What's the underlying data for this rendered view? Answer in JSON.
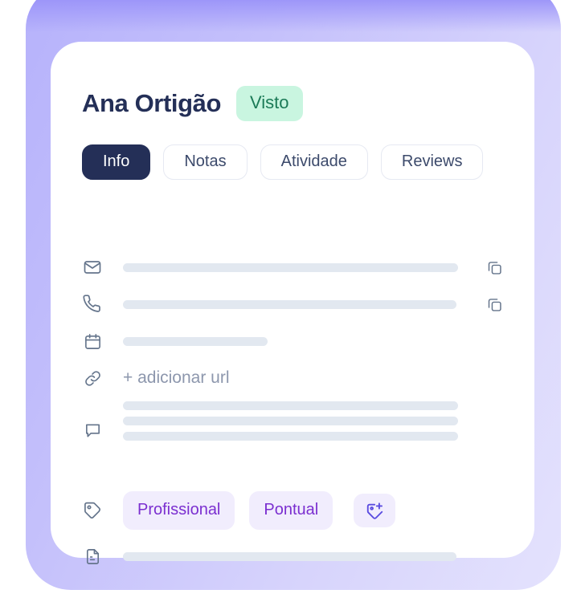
{
  "card": {
    "person_name": "Ana Ortigão",
    "status_badge": "Visto",
    "tabs": [
      {
        "label": "Info",
        "active": true
      },
      {
        "label": "Notas",
        "active": false
      },
      {
        "label": "Atividade",
        "active": false
      },
      {
        "label": "Reviews",
        "active": false
      }
    ],
    "rows": {
      "mail": {
        "icon": "mail-icon",
        "value": "",
        "copy_icon": "copy-icon"
      },
      "phone": {
        "icon": "phone-icon",
        "value": "",
        "copy_icon": "copy-icon"
      },
      "date": {
        "icon": "calendar-icon",
        "value": ""
      },
      "url": {
        "icon": "link-icon",
        "action_label": "+ adicionar url"
      },
      "notes": {
        "icon": "chat-bubble-icon",
        "value": ""
      },
      "tags": {
        "icon": "tag-icon",
        "chips": [
          "Profissional",
          "Pontual"
        ],
        "add_button_icon": "tag-plus-icon"
      },
      "file": {
        "icon": "document-icon",
        "value": ""
      }
    }
  },
  "colors": {
    "frame_purple": "#b6b2fb",
    "frame_purple_light": "#e4e2fd",
    "frame_glow": "#7d74f7",
    "card_bg": "#ffffff",
    "name_navy": "#242f57",
    "badge_bg": "#c9f5e0",
    "badge_text": "#1b7a57",
    "tab_active_bg": "#242f57",
    "tab_border": "#e6e9f2",
    "tab_text": "#3c4a6b",
    "placeholder_bar": "#e2e8f0",
    "icon_slate": "#64748b",
    "muted_text": "#8d97ad",
    "chip_bg": "#f1edfd",
    "chip_text": "#7b2fd0",
    "add_tag_icon": "#5a4ce0"
  }
}
